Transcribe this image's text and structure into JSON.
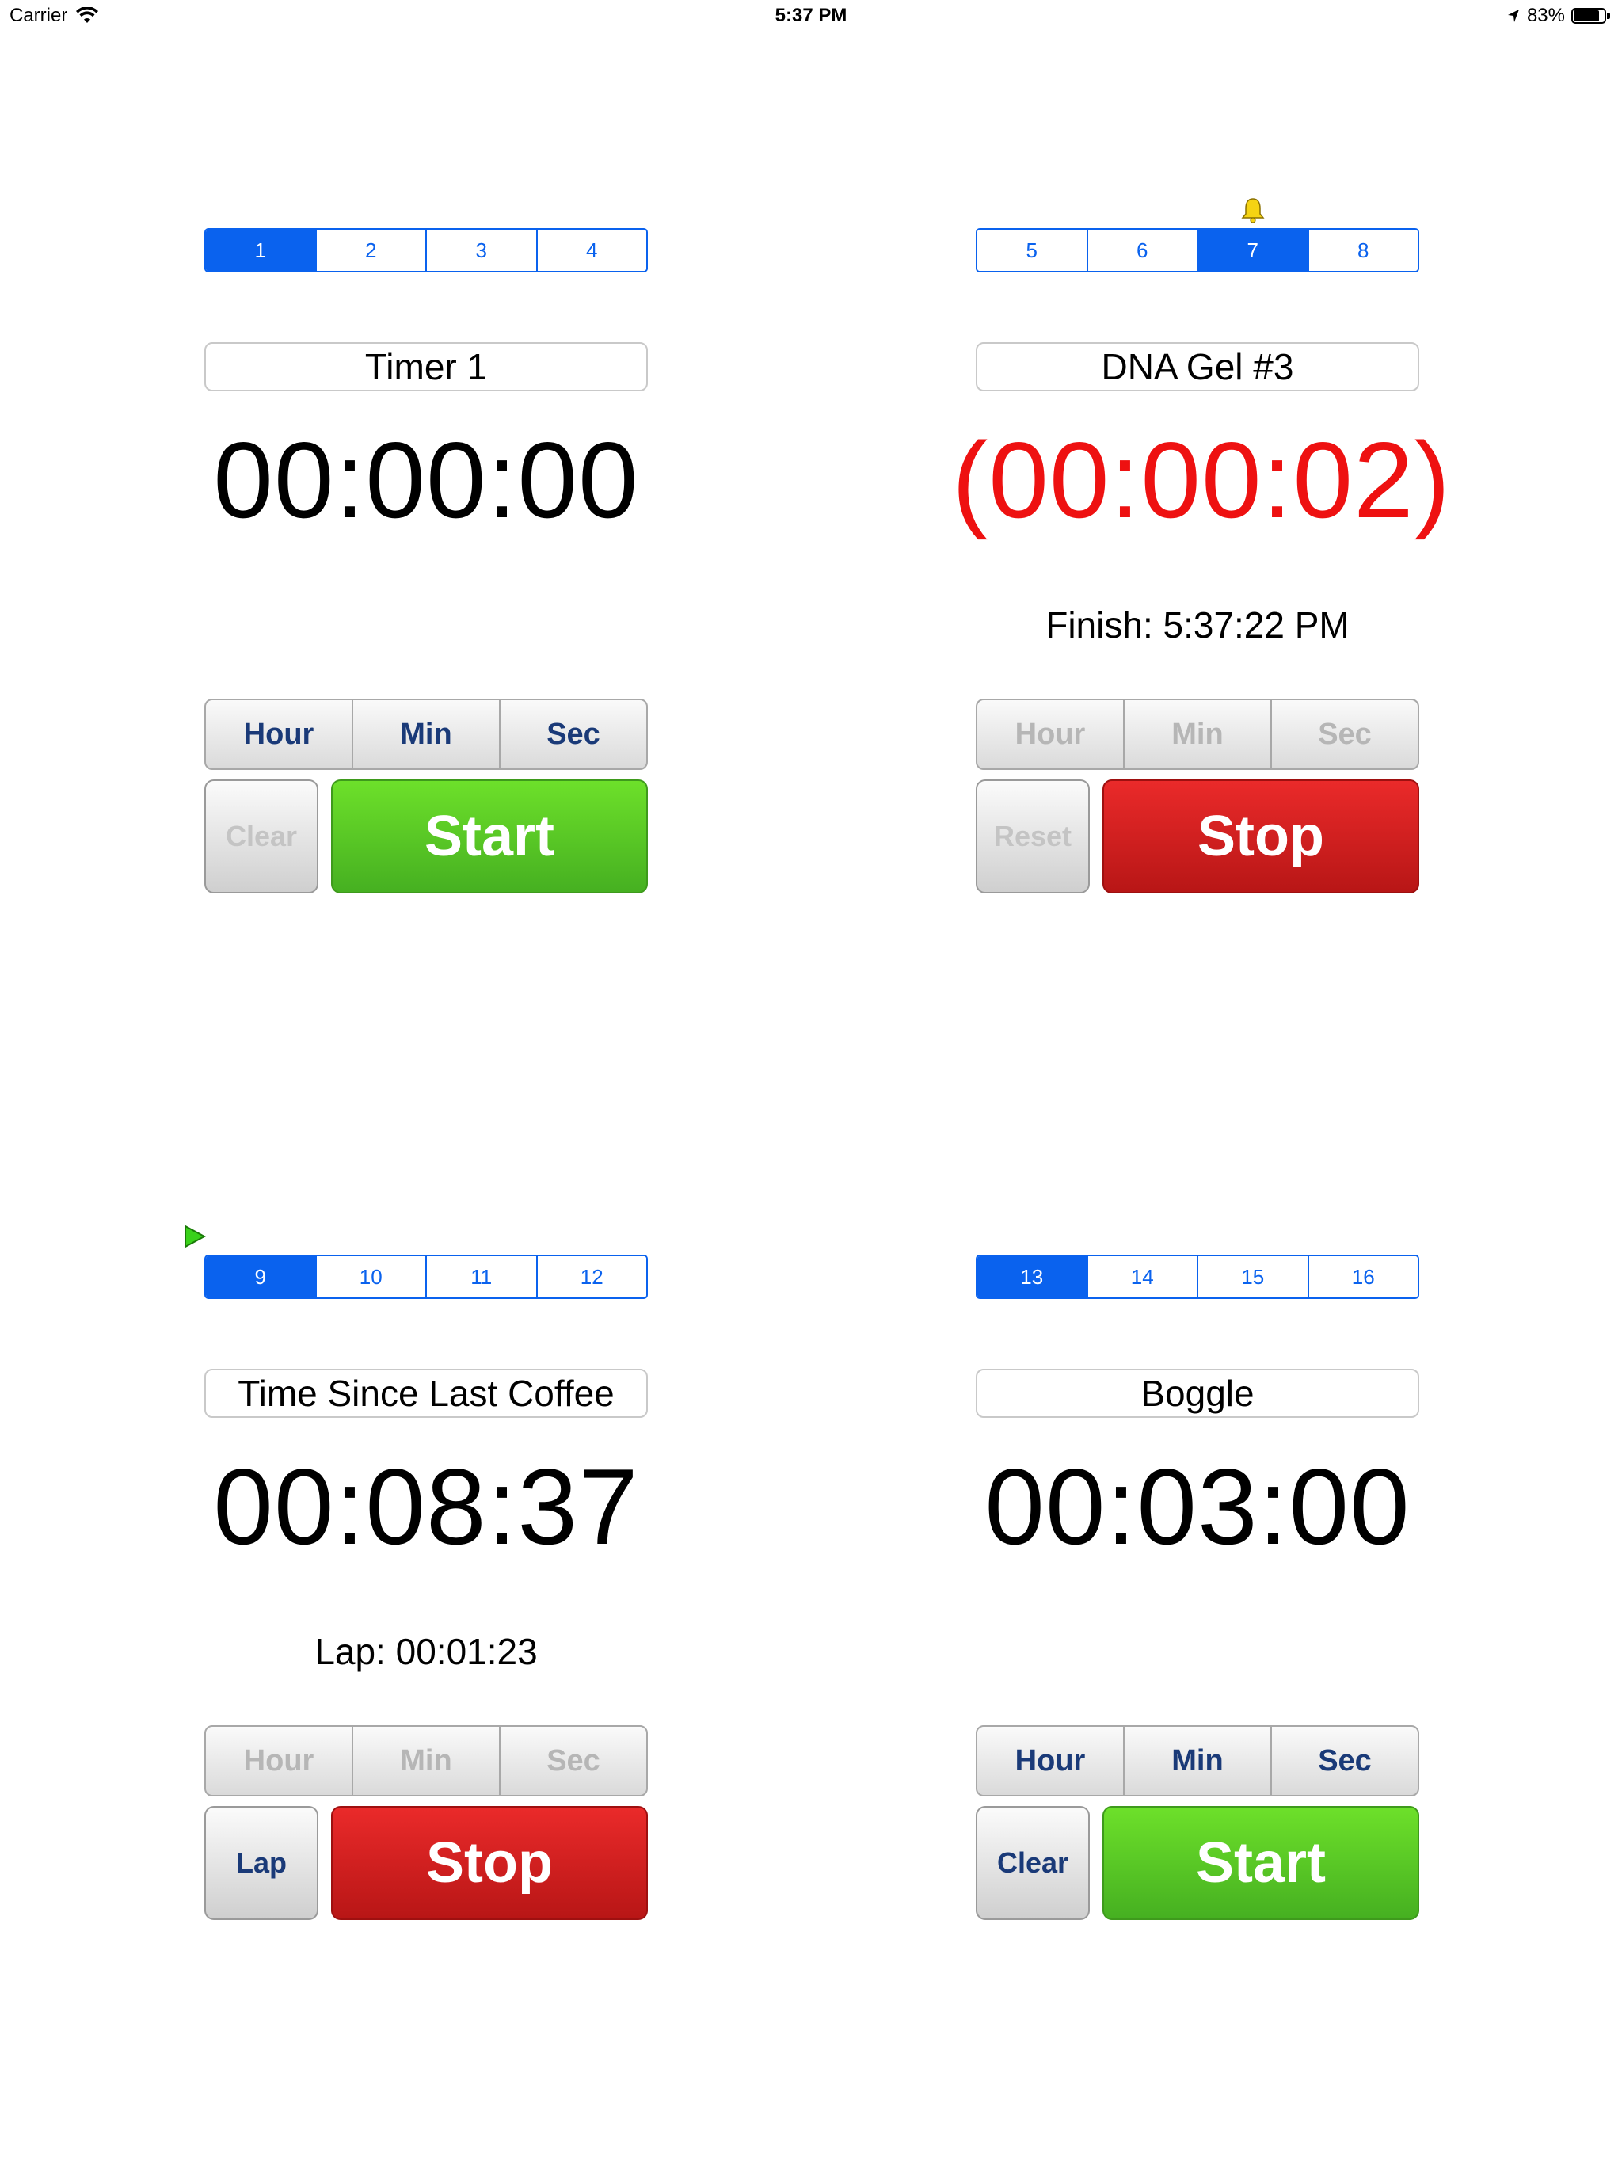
{
  "status_bar": {
    "carrier": "Carrier",
    "time": "5:37 PM",
    "battery": "83%",
    "battery_level": 0.83
  },
  "timers": [
    {
      "tabs": [
        "1",
        "2",
        "3",
        "4"
      ],
      "active_tab": 0,
      "marker": null,
      "name": "Timer 1",
      "clock": "00:00:00",
      "clock_color": "#000000",
      "subinfo": "",
      "hms": {
        "hour": "Hour",
        "min": "Min",
        "sec": "Sec",
        "enabled": true
      },
      "left_button": {
        "label": "Clear",
        "enabled": false
      },
      "main_button": {
        "label": "Start",
        "kind": "start",
        "color": "#57c925"
      }
    },
    {
      "tabs": [
        "5",
        "6",
        "7",
        "8"
      ],
      "active_tab": 2,
      "marker": "bell-icon",
      "name": "DNA Gel #3",
      "clock": "(00:00:02)",
      "clock_color": "#ee1111",
      "subinfo": "Finish: 5:37:22 PM",
      "hms": {
        "hour": "Hour",
        "min": "Min",
        "sec": "Sec",
        "enabled": false
      },
      "left_button": {
        "label": "Reset",
        "enabled": false
      },
      "main_button": {
        "label": "Stop",
        "kind": "stop",
        "color": "#d21f1f"
      }
    },
    {
      "tabs": [
        "9",
        "10",
        "11",
        "12"
      ],
      "active_tab": 0,
      "marker": "play-icon",
      "name": "Time Since Last Coffee",
      "clock": "00:08:37",
      "clock_color": "#000000",
      "subinfo": "Lap: 00:01:23",
      "hms": {
        "hour": "Hour",
        "min": "Min",
        "sec": "Sec",
        "enabled": false
      },
      "left_button": {
        "label": "Lap",
        "enabled": true
      },
      "main_button": {
        "label": "Stop",
        "kind": "stop",
        "color": "#d21f1f"
      }
    },
    {
      "tabs": [
        "13",
        "14",
        "15",
        "16"
      ],
      "active_tab": 0,
      "marker": null,
      "name": "Boggle",
      "clock": "00:03:00",
      "clock_color": "#000000",
      "subinfo": "",
      "hms": {
        "hour": "Hour",
        "min": "Min",
        "sec": "Sec",
        "enabled": true
      },
      "left_button": {
        "label": "Clear",
        "enabled": true
      },
      "main_button": {
        "label": "Start",
        "kind": "start",
        "color": "#57c925"
      }
    }
  ]
}
